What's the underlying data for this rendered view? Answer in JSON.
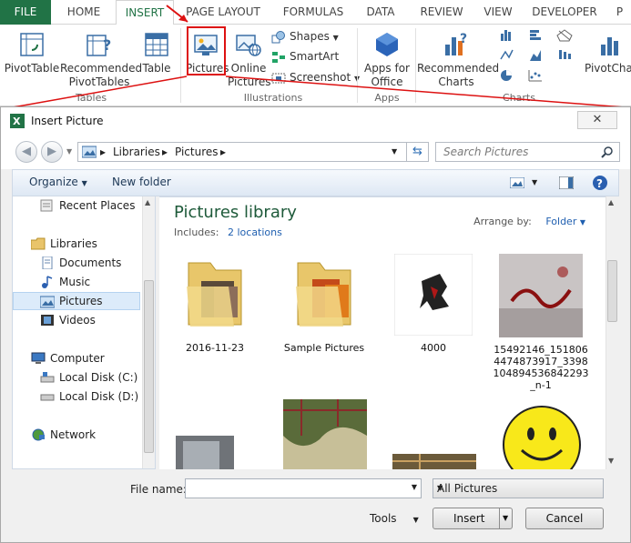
{
  "ribbon": {
    "tabs": [
      "FILE",
      "HOME",
      "INSERT",
      "PAGE LAYOUT",
      "FORMULAS",
      "DATA",
      "REVIEW",
      "VIEW",
      "DEVELOPER",
      "P"
    ],
    "active_tab": "INSERT",
    "pivottable": "PivotTable",
    "recommended_pivottables_1": "Recommended",
    "recommended_pivottables_2": "PivotTables",
    "table": "Table",
    "pictures": "Pictures",
    "online_pictures_1": "Online",
    "online_pictures_2": "Pictures",
    "shapes": "Shapes",
    "smartart": "SmartArt",
    "screenshot": "Screenshot",
    "apps_for_office_1": "Apps for",
    "apps_for_office_2": "Office",
    "recommended_charts_1": "Recommended",
    "recommended_charts_2": "Charts",
    "pivotchart": "PivotCha",
    "groups": {
      "tables": "Tables",
      "illustrations": "Illustrations",
      "apps": "Apps",
      "charts": "Charts"
    },
    "colors": {
      "file_tab": "#217346",
      "highlight": "#dd1111"
    }
  },
  "dialog": {
    "title": "Insert Picture",
    "close": "✕",
    "address": [
      "Libraries",
      "Pictures"
    ],
    "search_placeholder": "Search Pictures",
    "organize": "Organize",
    "new_folder": "New folder",
    "nav": [
      "Recent Places",
      "Libraries",
      "Documents",
      "Music",
      "Pictures",
      "Videos",
      "Computer",
      "Local Disk (C:)",
      "Local Disk (D:)",
      "Network"
    ],
    "selected_nav": "Pictures",
    "library_title": "Pictures library",
    "includes_label": "Includes:",
    "includes_value": "2 locations",
    "arrange_label": "Arrange by:",
    "arrange_value": "Folder",
    "files": [
      {
        "name": "2016-11-23"
      },
      {
        "name": "Sample Pictures"
      },
      {
        "name": "4000"
      },
      {
        "name": "15492146_1518064474873917_3398104894536842293_n-1"
      }
    ],
    "file_name_label": "File name:",
    "file_name_value": "",
    "filter": "All Pictures",
    "tools": "Tools",
    "insert": "Insert",
    "cancel": "Cancel"
  }
}
